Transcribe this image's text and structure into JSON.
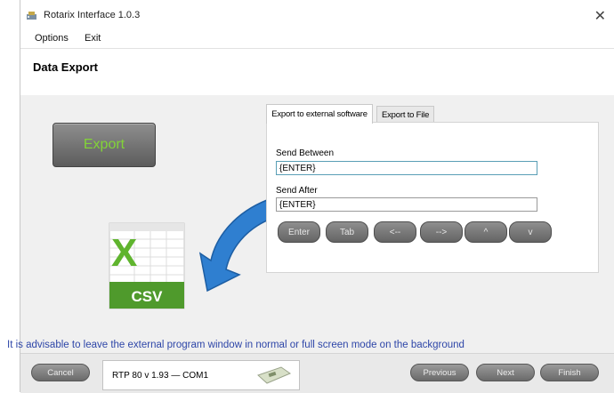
{
  "window": {
    "title": "Rotarix Interface 1.0.3",
    "close_glyph": "✕"
  },
  "menu": {
    "items": [
      "Options",
      "Exit"
    ]
  },
  "header": {
    "title": "Data Export"
  },
  "export_button": {
    "label": "Export",
    "text_color": "#82d437"
  },
  "graphic": {
    "file_letter": "X",
    "file_label": "CSV",
    "arrow_color": "#2f7fd0"
  },
  "tabs": [
    {
      "label": "Export to external software",
      "active": true
    },
    {
      "label": "Export to File",
      "active": false
    }
  ],
  "form": {
    "send_between_label": "Send Between",
    "send_between_value": "{ENTER}",
    "send_after_label": "Send After",
    "send_after_value": "{ENTER}"
  },
  "keys": [
    "Enter",
    "Tab",
    "<--",
    "-->",
    "^",
    "v"
  ],
  "advice": "It is advisable to leave the external program window  in normal or full screen mode on the background",
  "advice_color": "#2e46a8",
  "footer": {
    "cancel_label": "Cancel",
    "device_text": "RTP 80  v 1.93  —  COM1",
    "previous_label": "Previous",
    "next_label": "Next",
    "finish_label": "Finish"
  }
}
